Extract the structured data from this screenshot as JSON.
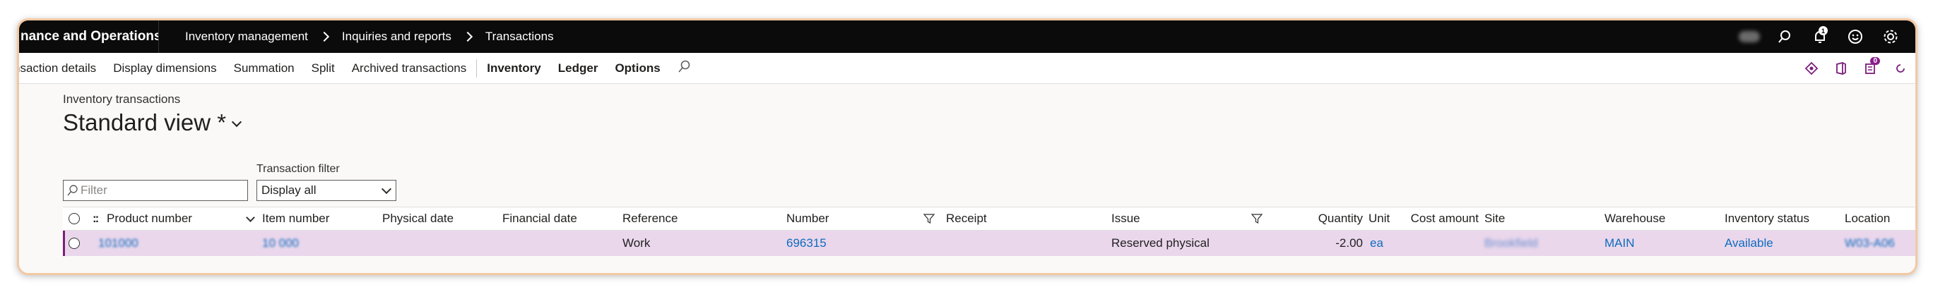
{
  "app": {
    "name": "nance and Operations"
  },
  "breadcrumb": [
    "Inventory management",
    "Inquiries and reports",
    "Transactions"
  ],
  "top_icons": [
    "account-icon",
    "search-icon",
    "notifications-icon",
    "feedback-smiley-icon",
    "settings-icon"
  ],
  "notifications_count": "1",
  "action_pane": {
    "items": [
      {
        "label": "nsaction details",
        "bold": false
      },
      {
        "label": "Display dimensions",
        "bold": false
      },
      {
        "label": "Summation",
        "bold": false
      },
      {
        "label": "Split",
        "bold": false
      },
      {
        "label": "Archived transactions",
        "bold": false
      },
      {
        "label": "Inventory",
        "bold": true
      },
      {
        "label": "Ledger",
        "bold": true
      },
      {
        "label": "Options",
        "bold": true
      }
    ],
    "right_badge_count": "0"
  },
  "page": {
    "caption": "Inventory transactions",
    "view_title": "Standard view *",
    "filter_placeholder": "Filter",
    "transaction_filter_label": "Transaction filter",
    "transaction_filter_value": "Display all"
  },
  "grid": {
    "columns": {
      "product_number": "Product number",
      "item_number": "Item number",
      "physical_date": "Physical date",
      "financial_date": "Financial date",
      "reference": "Reference",
      "number": "Number",
      "receipt": "Receipt",
      "issue": "Issue",
      "quantity": "Quantity",
      "unit": "Unit",
      "cost_amount": "Cost amount",
      "site": "Site",
      "warehouse": "Warehouse",
      "inventory_status": "Inventory status",
      "location": "Location"
    },
    "rows": [
      {
        "product_number": "101000",
        "item_number": "10 000",
        "physical_date": "",
        "financial_date": "",
        "reference": "Work",
        "number": "696315",
        "receipt": "",
        "issue": "Reserved physical",
        "quantity": "-2.00",
        "unit": "ea",
        "cost_amount": "",
        "site": "Brookfield",
        "warehouse": "MAIN",
        "inventory_status": "Available",
        "location": "W03-A06"
      }
    ]
  },
  "colors": {
    "topbar": "#0b0b0b",
    "selected_row": "#ead7ec",
    "link": "#0f6cbd",
    "accent": "#7a1f7a"
  }
}
